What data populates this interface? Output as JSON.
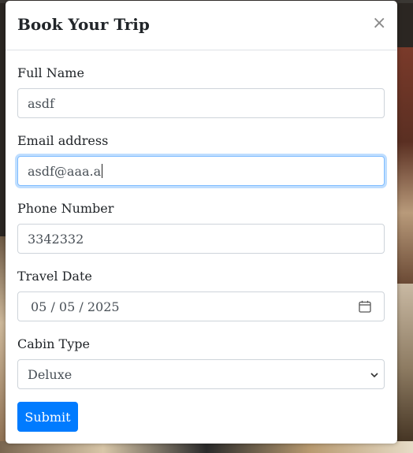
{
  "modal": {
    "title": "Book Your Trip",
    "close_label": "×"
  },
  "form": {
    "full_name": {
      "label": "Full Name",
      "value": "asdf"
    },
    "email": {
      "label": "Email address",
      "value": "asdf@aaa.a"
    },
    "phone": {
      "label": "Phone Number",
      "value": "3342332"
    },
    "travel_date": {
      "label": "Travel Date",
      "value": "05 / 05 / 2025"
    },
    "cabin_type": {
      "label": "Cabin Type",
      "value": "Deluxe"
    },
    "submit_label": "Submit"
  },
  "icons": {
    "close": "close-icon",
    "calendar": "calendar-icon",
    "dropdown": "chevron-down-icon"
  },
  "colors": {
    "primary": "#007bff",
    "focus_border": "#80bdff",
    "input_border": "#ced4da",
    "text": "#212529"
  }
}
